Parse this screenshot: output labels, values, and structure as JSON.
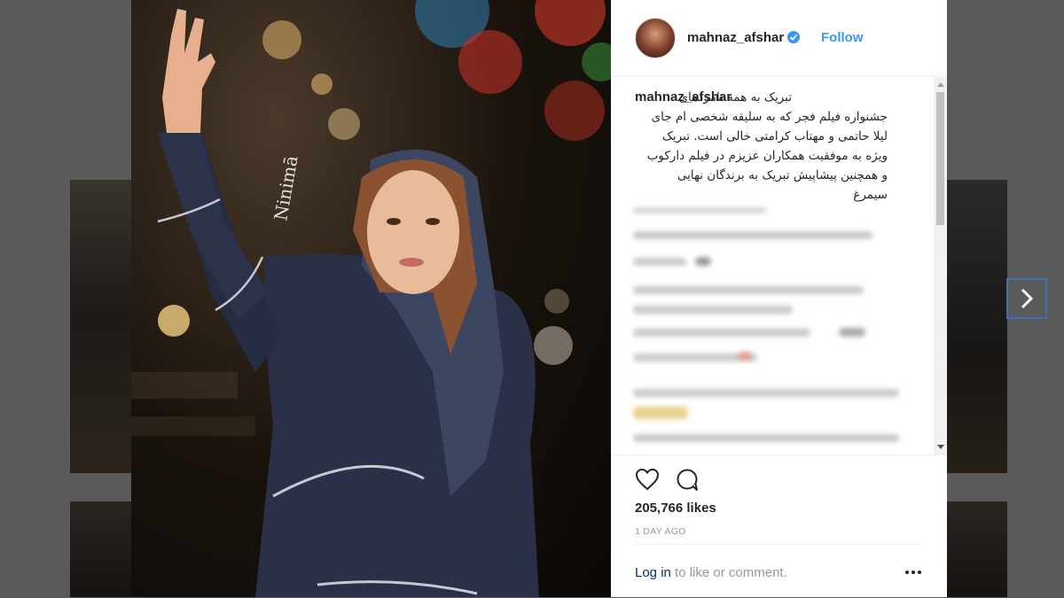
{
  "post": {
    "username": "mahnaz_afshar",
    "follow_label": "Follow",
    "caption_user": "mahnaz_afshar",
    "caption_lines": [
      "تبریک به همه نامزدهای",
      "جشنواره فیلم فجر که به سلیقه شخصی ام جای",
      "لیلا حاتمی و مهتاب کرامتی خالی است. تبریک",
      "ویژه به موفقیت همکاران عزیزم در فیلم دارکوب",
      "و همچنین پیشاپیش تبریک به برندگان نهایی",
      "سیمرغ"
    ],
    "likes": "205,766 likes",
    "timestamp": "1 DAY AGO",
    "login_link": "Log in",
    "login_rest": " to like or comment."
  },
  "colors": {
    "link_blue": "#3897f0",
    "verified_blue": "#3897f0",
    "dark_text": "#262626",
    "muted_text": "#999999"
  },
  "icons": [
    "heart-icon",
    "comment-icon",
    "verified-badge-icon",
    "more-options-icon",
    "chevron-right-icon"
  ]
}
